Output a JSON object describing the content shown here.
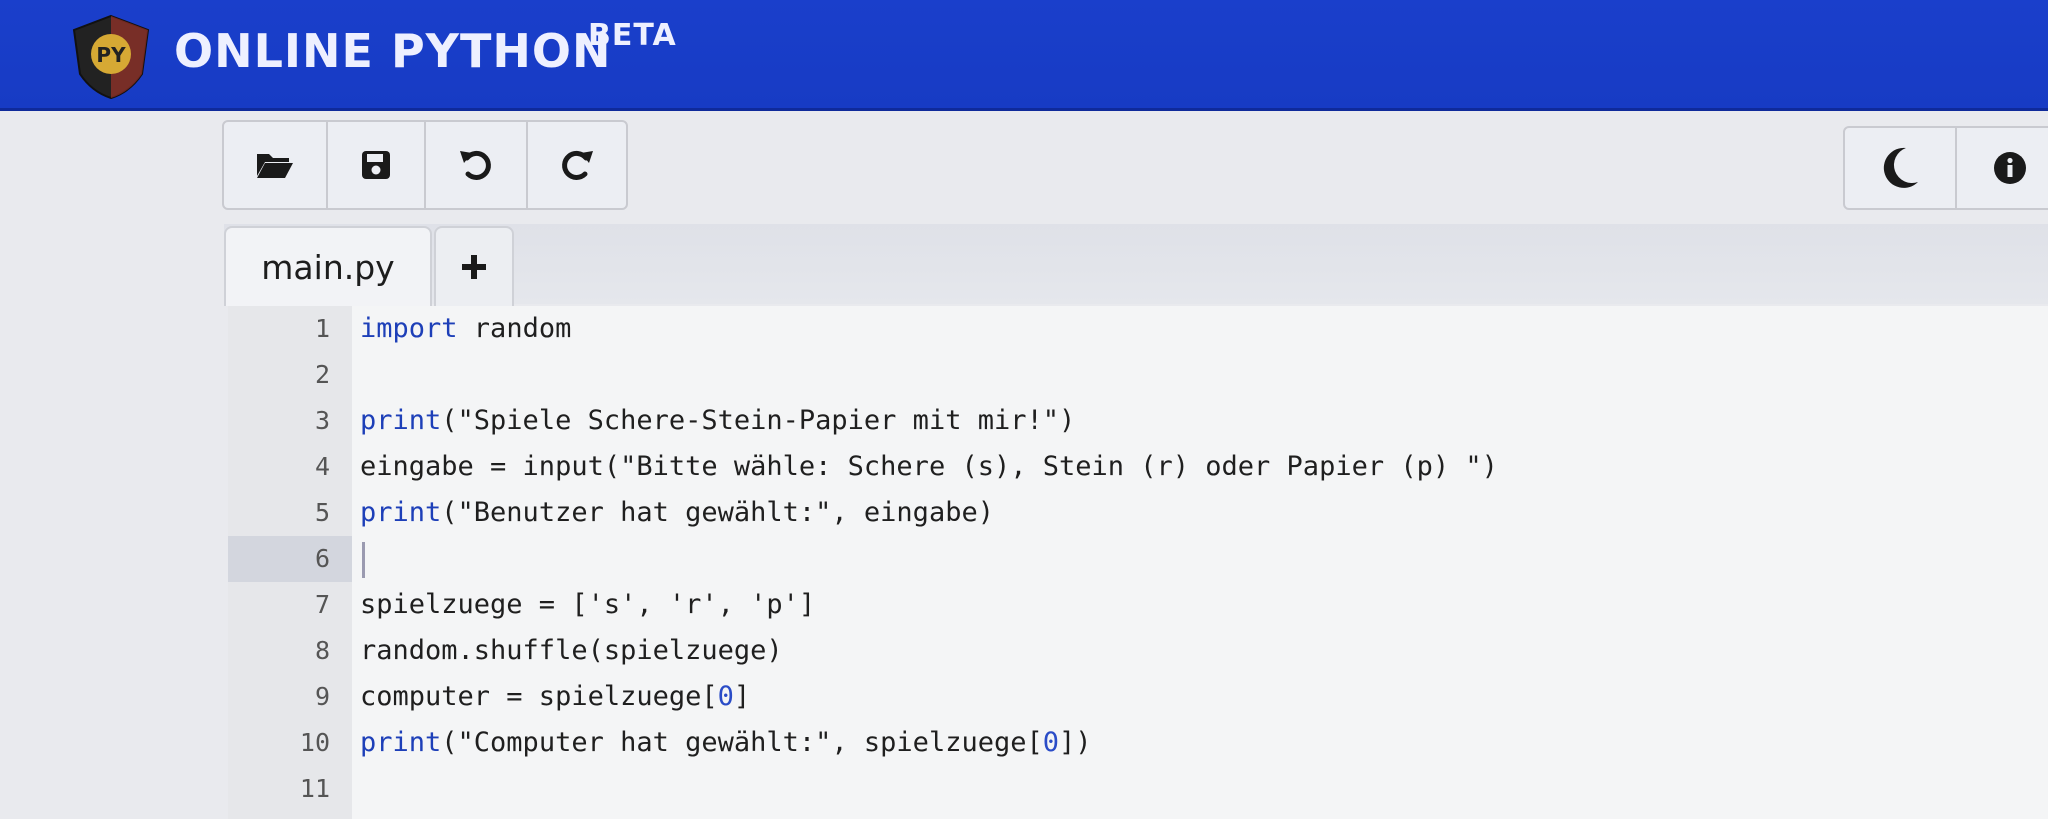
{
  "header": {
    "title": "ONLINE PYTHON",
    "badge": "BETA",
    "logo_text": "PY"
  },
  "toolbar": {
    "left_buttons": [
      {
        "name": "open-folder-icon",
        "label": "Open"
      },
      {
        "name": "save-icon",
        "label": "Save"
      },
      {
        "name": "undo-icon",
        "label": "Undo"
      },
      {
        "name": "redo-icon",
        "label": "Redo"
      }
    ],
    "right_buttons": [
      {
        "name": "dark-mode-icon",
        "label": "Dark mode"
      },
      {
        "name": "info-icon",
        "label": "Info"
      }
    ]
  },
  "tabs": {
    "items": [
      {
        "label": "main.py",
        "active": true
      }
    ],
    "add_label": "+"
  },
  "editor": {
    "active_line": 6,
    "lines": [
      {
        "n": "1",
        "kw": "import",
        "rest": " random"
      },
      {
        "n": "2",
        "kw": "",
        "rest": ""
      },
      {
        "n": "3",
        "kw": "print",
        "rest": "(\"Spiele Schere-Stein-Papier mit mir!\")"
      },
      {
        "n": "4",
        "kw": "",
        "rest": "eingabe = input(\"Bitte wähle: Schere (s), Stein (r) oder Papier (p) \")"
      },
      {
        "n": "5",
        "kw": "print",
        "rest": "(\"Benutzer hat gewählt:\", eingabe)"
      },
      {
        "n": "6",
        "kw": "",
        "rest": ""
      },
      {
        "n": "7",
        "kw": "",
        "rest": "spielzuege = ['s', 'r', 'p']"
      },
      {
        "n": "8",
        "kw": "",
        "rest": "random.shuffle(spielzuege)"
      },
      {
        "n": "9",
        "kw": "",
        "rest": "computer = spielzuege[0]"
      },
      {
        "n": "10",
        "kw": "print",
        "rest": "(\"Computer hat gewählt:\", spielzuege[0])"
      },
      {
        "n": "11",
        "kw": "",
        "rest": ""
      }
    ]
  },
  "colors": {
    "header_bg": "#1a3fcb",
    "keyword": "#1d3fb8",
    "editor_bg": "#f4f5f6"
  }
}
